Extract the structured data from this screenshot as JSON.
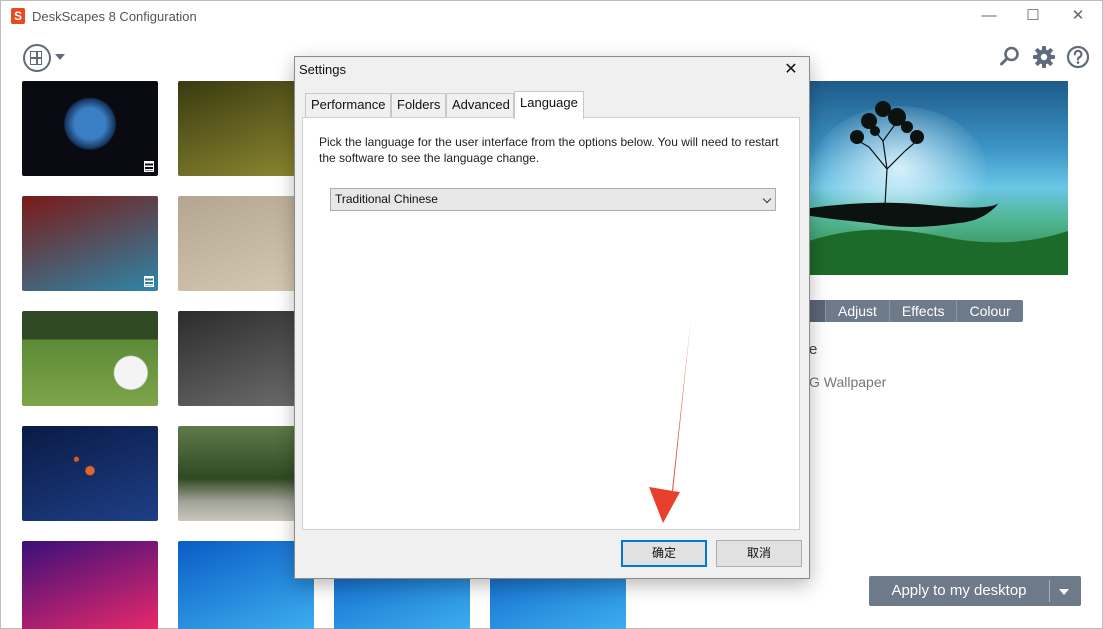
{
  "app": {
    "title": "DeskScapes 8 Configuration",
    "logo_letter": "S",
    "controls": {
      "minimize": "—",
      "maximize": "☐",
      "close": "✕"
    }
  },
  "toolbar": {
    "view_icon": "view-mode-icon",
    "search_icon": "search-icon",
    "settings_icon": "gear-icon",
    "help_icon": "help-icon"
  },
  "thumbnails": [
    {
      "name": "earth",
      "colors": [
        "#0a0a12",
        "#1e4f8a"
      ],
      "video": true
    },
    {
      "name": "grass-closeup",
      "colors": [
        "#3a3a10",
        "#8e8a32"
      ],
      "video": false
    },
    {
      "name": "retro-girl-car",
      "colors": [
        "#7a1a16",
        "#2d86a8"
      ],
      "video": true
    },
    {
      "name": "sand",
      "colors": [
        "#b3a590",
        "#d7cab4"
      ],
      "video": false
    },
    {
      "name": "golf-ball",
      "colors": [
        "#3f6a2a",
        "#7fa44a"
      ],
      "video": false
    },
    {
      "name": "cats",
      "colors": [
        "#2c2c2c",
        "#6e6e6e"
      ],
      "video": false
    },
    {
      "name": "space-planets",
      "colors": [
        "#0a1a45",
        "#1e3f86"
      ],
      "video": false
    },
    {
      "name": "tree-lined-road",
      "colors": [
        "#3f5e2a",
        "#aeb7a0"
      ],
      "video": false
    },
    {
      "name": "purple-equalizer",
      "colors": [
        "#3a0f7a",
        "#f02a6a"
      ],
      "video": false
    },
    {
      "name": "windows-blue-1",
      "colors": [
        "#0a5cc6",
        "#3fb2f0"
      ],
      "video": false
    },
    {
      "name": "windows-blue-2",
      "colors": [
        "#0a5cc6",
        "#3fb2f0"
      ],
      "video": false
    },
    {
      "name": "windows-blue-3",
      "colors": [
        "#0a5cc6",
        "#3fb2f0"
      ],
      "video": false
    }
  ],
  "detail": {
    "tabs": [
      "Adjust",
      "Effects",
      "Colour"
    ],
    "title_fragment": "e",
    "subtitle_fragment": "G Wallpaper",
    "apply_label": "Apply to my desktop"
  },
  "dialog": {
    "title": "Settings",
    "close": "✕",
    "tabs": [
      "Performance",
      "Folders",
      "Advanced",
      "Language"
    ],
    "active_tab": "Language",
    "description": "Pick the language for the user interface from the options below.  You will need to restart the software to see the language change.",
    "language_selected": "Traditional Chinese",
    "ok_label": "确定",
    "cancel_label": "取消"
  },
  "annotation": {
    "arrow_color": "#e8402a"
  },
  "colors": {
    "accent_gray": "#6d7a8a",
    "dialog_focus": "#0078d7"
  }
}
